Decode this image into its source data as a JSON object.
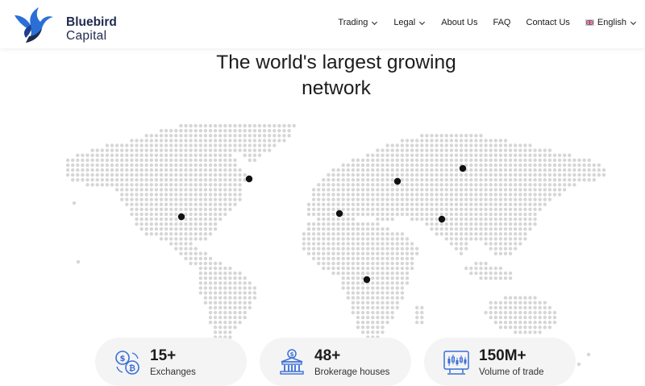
{
  "brand": {
    "name_line1": "Bluebird",
    "name_line2": "Capital"
  },
  "nav": {
    "trading": "Trading",
    "legal": "Legal",
    "about": "About Us",
    "faq": "FAQ",
    "contact": "Contact Us",
    "language": "English"
  },
  "hero": {
    "title_line1": "The world's largest growing",
    "title_line2": "network"
  },
  "stats": [
    {
      "value": "15+",
      "label": "Exchanges",
      "icon": "crypto-coins-icon"
    },
    {
      "value": "48+",
      "label": "Brokerage houses",
      "icon": "bank-building-icon"
    },
    {
      "value": "150M+",
      "label": "Volume of trade",
      "icon": "trading-chart-icon"
    }
  ],
  "colors": {
    "brand_navy": "#1f2b4e",
    "brand_blue": "#2b6fd6",
    "icon_blue": "#3b6fd8",
    "map_dot": "#d6d6d6",
    "marker": "#111111"
  }
}
